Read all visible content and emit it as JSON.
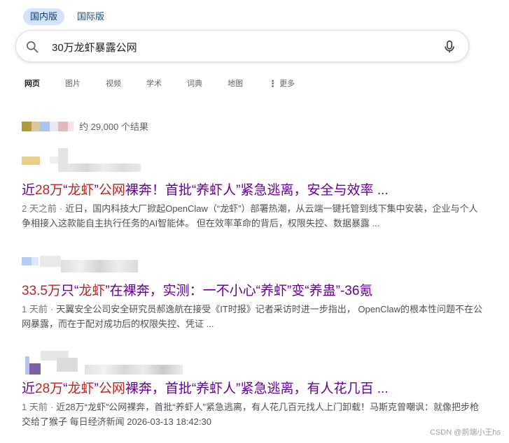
{
  "region_tabs": [
    "国内版",
    "国际版"
  ],
  "search": {
    "query": "30万龙虾暴露公网"
  },
  "nav_tabs": [
    "网页",
    "图片",
    "视频",
    "学术",
    "词典",
    "地图"
  ],
  "nav_more": "更多",
  "stats": {
    "text": "约 29,000 个结果"
  },
  "results": [
    {
      "title": "近28万“龙虾”公网裸奔！首批“养虾人”紧急逃离，安全与效率 ...",
      "age": "2 天之前",
      "snippet": "近日，国内科技大厂掀起OpenClaw（“龙虾”）部署热潮，从云端一键托管到线下集中安装，企业与个人争相接入这款能自主执行任务的AI智能体。 但在效率革命的背后，权限失控、数据暴露 ..."
    },
    {
      "title": "33.5万只“龙虾”在裸奔，实测：一不小心“养虾”变“养蛊”-36氪",
      "age": "1 天前",
      "snippet": "天翼安全公司安全研究员郝逸航在接受《IT时报》记者采访时进一步指出， OpenClaw的根本性问题不在公网暴露，而在于配对成功后的权限失控、凭证 ..."
    },
    {
      "title": "近28万“龙虾”公网裸奔，首批“养虾人”紧急逃离，有人花几百 ...",
      "age": "1 天前",
      "snippet": "近28万“龙虾”公网裸奔，首批“养虾人”紧急逃离，有人花几百元找人上门卸载！马斯克曾嘲讽：就像把步枪交给了猴子 每日经济新闻 2026-03-13 18:42:30"
    }
  ],
  "watermark": "CSDN @前端小王hs",
  "colors": {
    "title_visited": "#660099",
    "title_highlight": "#c5221f",
    "tab_active_bg": "#d3e3fd"
  }
}
